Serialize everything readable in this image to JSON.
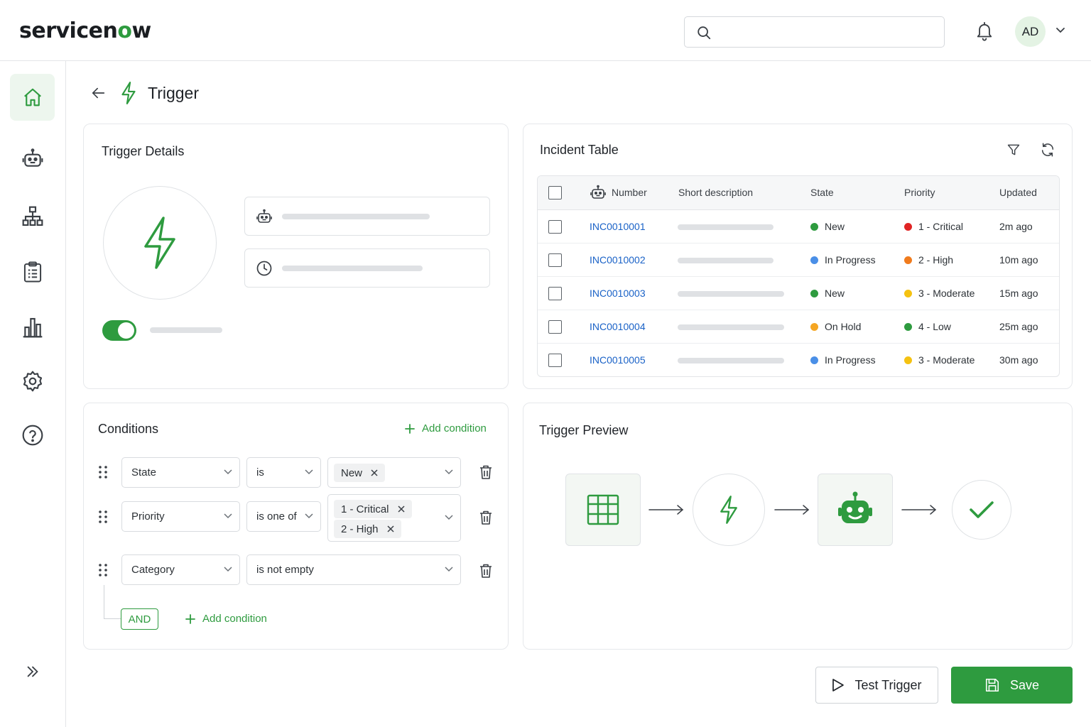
{
  "header": {
    "logo_pre": "servicen",
    "logo_o": "o",
    "logo_post": "w",
    "search_placeholder": "",
    "avatar_initials": "AD"
  },
  "sidebar": {
    "items": [
      {
        "icon": "home-icon",
        "active": true
      },
      {
        "icon": "robot-icon"
      },
      {
        "icon": "hierarchy-icon"
      },
      {
        "icon": "clipboard-icon"
      },
      {
        "icon": "bar-chart-icon"
      },
      {
        "icon": "gear-icon"
      },
      {
        "icon": "help-icon"
      },
      {
        "icon": "expand-icon"
      }
    ]
  },
  "page": {
    "title": "Trigger"
  },
  "trigger_details": {
    "title": "Trigger Details",
    "toggle_on": true
  },
  "incident_table": {
    "title": "Incident Table",
    "columns": [
      "Number",
      "Short description",
      "State",
      "Priority",
      "Updated"
    ],
    "rows": [
      {
        "number": "INC0010001",
        "state": "New",
        "state_color": "#2e9b3f",
        "priority": "1 - Critical",
        "priority_color": "#e02424",
        "updated": "2m ago"
      },
      {
        "number": "INC0010002",
        "state": "In Progress",
        "state_color": "#4a8fe7",
        "priority": "2 - High",
        "priority_color": "#f07b1d",
        "updated": "10m ago"
      },
      {
        "number": "INC0010003",
        "state": "New",
        "state_color": "#2e9b3f",
        "priority": "3 - Moderate",
        "priority_color": "#f5c211",
        "updated": "15m ago"
      },
      {
        "number": "INC0010004",
        "state": "On Hold",
        "state_color": "#f5a623",
        "priority": "4 - Low",
        "priority_color": "#2e9b3f",
        "updated": "25m ago"
      },
      {
        "number": "INC0010005",
        "state": "In Progress",
        "state_color": "#4a8fe7",
        "priority": "3 - Moderate",
        "priority_color": "#f5c211",
        "updated": "30m ago"
      }
    ]
  },
  "conditions": {
    "title": "Conditions",
    "add_condition_label": "Add condition",
    "rows": [
      {
        "field": "State",
        "operator": "is",
        "values": [
          "New"
        ]
      },
      {
        "field": "Priority",
        "operator": "is one of",
        "values": [
          "1 - Critical",
          "2 - High"
        ]
      },
      {
        "field": "Category",
        "operator": "is not empty",
        "values": []
      }
    ],
    "and_label": "AND",
    "add_condition_bottom_label": "Add condition"
  },
  "trigger_preview": {
    "title": "Trigger Preview",
    "nodes": [
      "table-icon",
      "bolt-icon",
      "robot-icon",
      "check-icon"
    ]
  },
  "footer": {
    "test_trigger_label": "Test Trigger",
    "save_label": "Save"
  },
  "colors": {
    "brand_green": "#2e9b3f",
    "link_blue": "#1a62c7"
  }
}
